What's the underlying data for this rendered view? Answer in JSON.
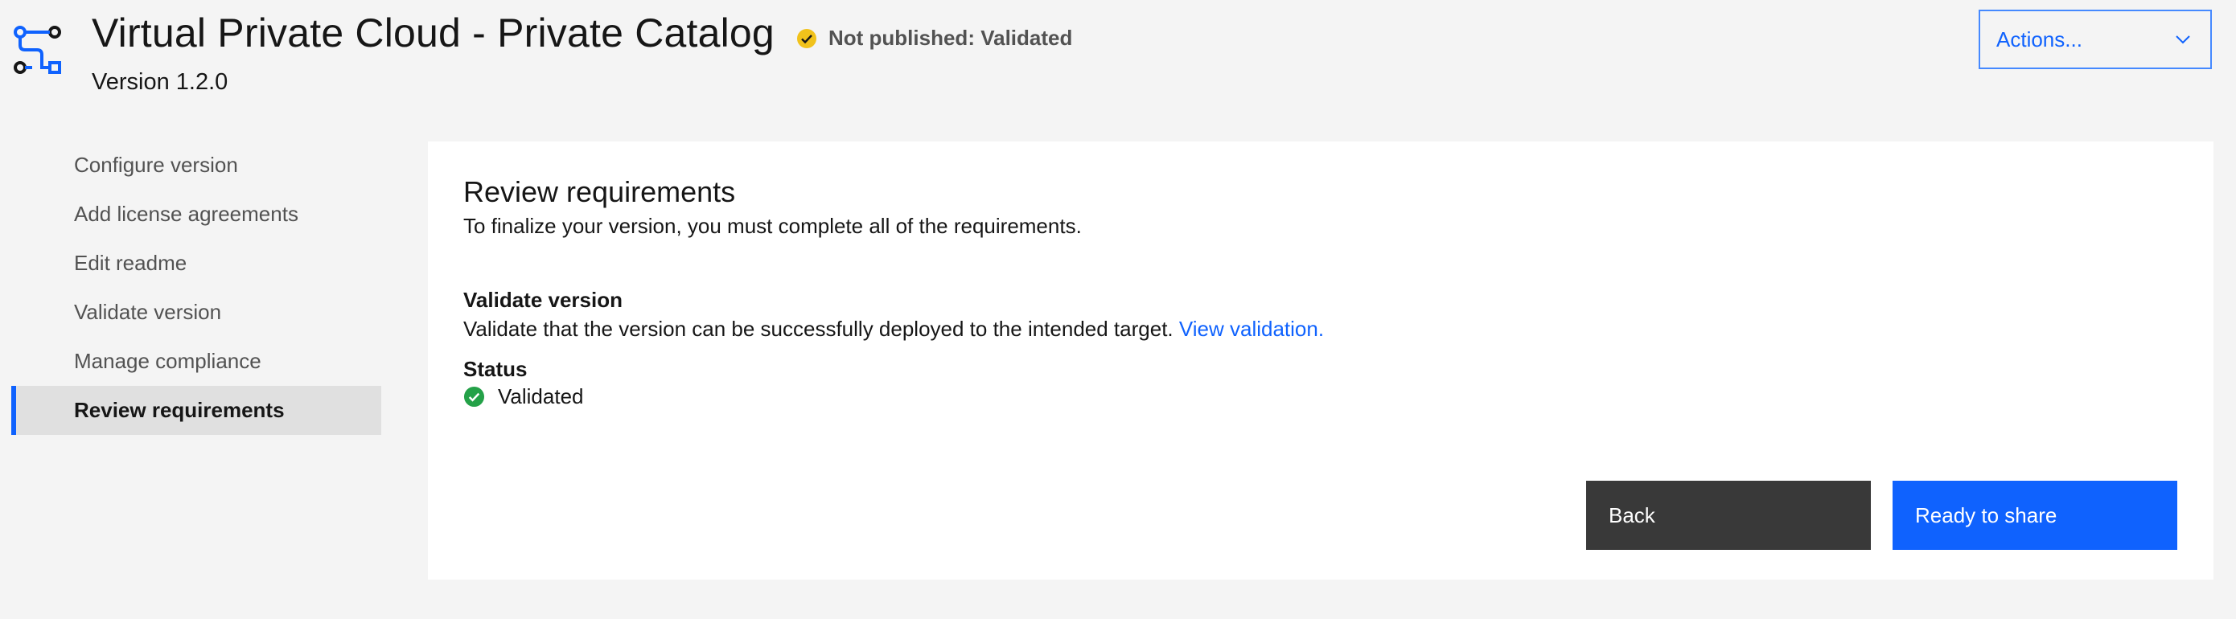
{
  "header": {
    "title": "Virtual Private Cloud - Private Catalog",
    "version": "Version 1.2.0",
    "status": "Not published: Validated",
    "status_color": "#f1c21b",
    "icon": "catalog-flow-icon",
    "actions_label": "Actions..."
  },
  "sidebar": {
    "items": [
      {
        "label": "Configure version"
      },
      {
        "label": "Add license agreements"
      },
      {
        "label": "Edit readme"
      },
      {
        "label": "Validate version"
      },
      {
        "label": "Manage compliance"
      },
      {
        "label": "Review requirements"
      }
    ],
    "active_index": 5
  },
  "main": {
    "title": "Review requirements",
    "subtitle": "To finalize your version, you must complete all of the requirements.",
    "requirement": {
      "title": "Validate version",
      "description": "Validate that the version can be successfully deployed to the intended target.",
      "link": "View validation.",
      "status_label": "Status",
      "status_value": "Validated",
      "status_color": "#24a148"
    },
    "buttons": {
      "back": "Back",
      "ready": "Ready to share"
    }
  },
  "colors": {
    "accent": "#0f62fe",
    "background": "#f4f4f4",
    "panel": "#ffffff",
    "secondary_button": "#393939"
  }
}
